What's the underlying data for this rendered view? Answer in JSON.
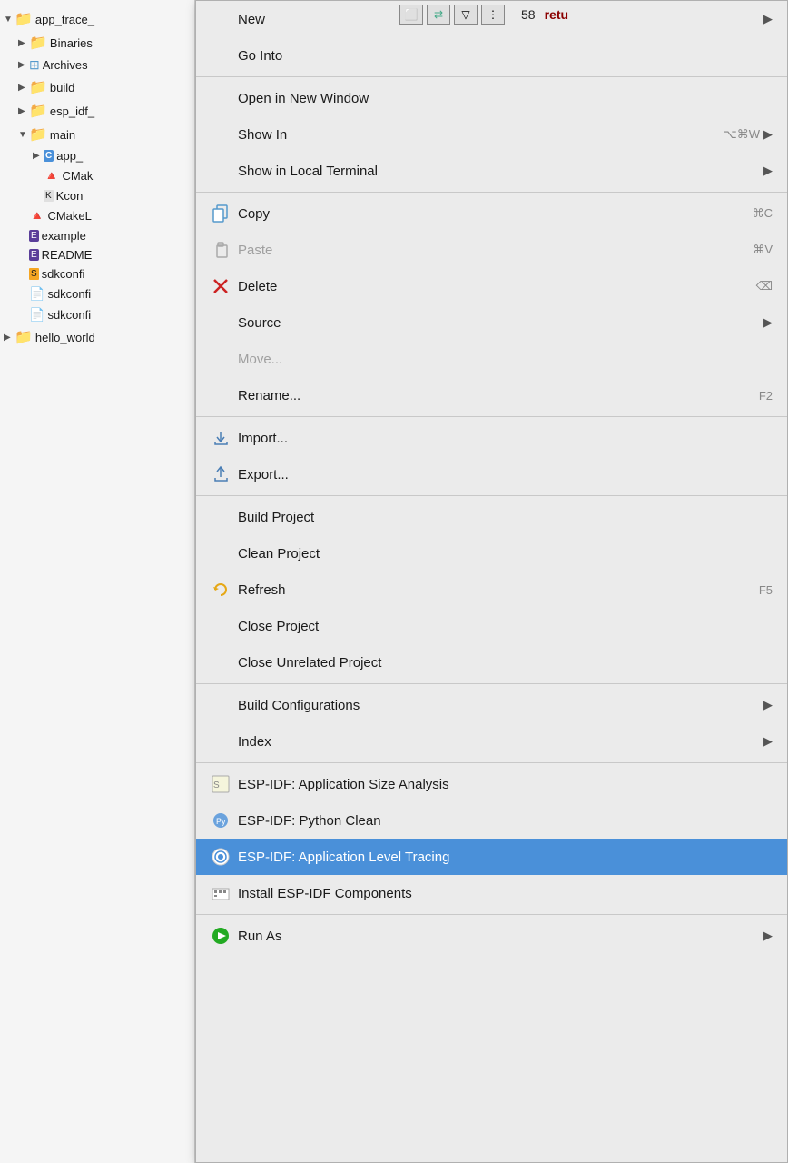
{
  "toolbar": {
    "line_number": "58",
    "return_text": "retu"
  },
  "sidebar": {
    "items": [
      {
        "id": "app_trace",
        "label": "app_trace_",
        "indent": 1,
        "arrow": "expanded",
        "icon": "project"
      },
      {
        "id": "binaries",
        "label": "Binaries",
        "indent": 2,
        "arrow": "collapsed",
        "icon": "folder"
      },
      {
        "id": "archives",
        "label": "Archives",
        "indent": 2,
        "arrow": "collapsed",
        "icon": "grid"
      },
      {
        "id": "build",
        "label": "build",
        "indent": 2,
        "arrow": "collapsed",
        "icon": "folder"
      },
      {
        "id": "esp_idf",
        "label": "esp_idf_",
        "indent": 2,
        "arrow": "collapsed",
        "icon": "folder"
      },
      {
        "id": "main",
        "label": "main",
        "indent": 2,
        "arrow": "expanded",
        "icon": "folder"
      },
      {
        "id": "app_c",
        "label": "app_",
        "indent": 3,
        "arrow": "collapsed",
        "icon": "c-file"
      },
      {
        "id": "cmake_main",
        "label": "CMak",
        "indent": 3,
        "arrow": "leaf",
        "icon": "cmake"
      },
      {
        "id": "kcon",
        "label": "Kcon",
        "indent": 3,
        "arrow": "leaf",
        "icon": "kconfig"
      },
      {
        "id": "cmakel",
        "label": "CMakeL",
        "indent": 2,
        "arrow": "leaf",
        "icon": "cmake"
      },
      {
        "id": "example",
        "label": "example",
        "indent": 2,
        "arrow": "leaf",
        "icon": "esp-file"
      },
      {
        "id": "readme",
        "label": "README",
        "indent": 2,
        "arrow": "leaf",
        "icon": "esp-file"
      },
      {
        "id": "sdkconfi1",
        "label": "sdkconfi",
        "indent": 2,
        "arrow": "leaf",
        "icon": "sdk1"
      },
      {
        "id": "sdkconfi2",
        "label": "sdkconfi",
        "indent": 2,
        "arrow": "leaf",
        "icon": "doc"
      },
      {
        "id": "sdkconfi3",
        "label": "sdkconfi",
        "indent": 2,
        "arrow": "leaf",
        "icon": "doc"
      },
      {
        "id": "hello_world",
        "label": "hello_world",
        "indent": 1,
        "arrow": "collapsed",
        "icon": "folder"
      }
    ]
  },
  "context_menu": {
    "items": [
      {
        "id": "new",
        "label": "New",
        "type": "arrow",
        "shortcut": "",
        "icon": "none",
        "disabled": false
      },
      {
        "id": "go_into",
        "label": "Go Into",
        "type": "normal",
        "shortcut": "",
        "icon": "none",
        "disabled": false
      },
      {
        "id": "sep1",
        "type": "separator"
      },
      {
        "id": "open_new_window",
        "label": "Open in New Window",
        "type": "normal",
        "shortcut": "",
        "icon": "none",
        "disabled": false
      },
      {
        "id": "show_in",
        "label": "Show In",
        "type": "arrow",
        "shortcut": "⌥⌘W",
        "icon": "none",
        "disabled": false
      },
      {
        "id": "show_local_terminal",
        "label": "Show in Local Terminal",
        "type": "arrow",
        "shortcut": "",
        "icon": "none",
        "disabled": false
      },
      {
        "id": "sep2",
        "type": "separator"
      },
      {
        "id": "copy",
        "label": "Copy",
        "type": "normal",
        "shortcut": "⌘C",
        "icon": "copy",
        "disabled": false
      },
      {
        "id": "paste",
        "label": "Paste",
        "type": "normal",
        "shortcut": "⌘V",
        "icon": "paste",
        "disabled": true
      },
      {
        "id": "delete",
        "label": "Delete",
        "type": "normal",
        "shortcut": "⌫",
        "icon": "delete",
        "disabled": false
      },
      {
        "id": "source",
        "label": "Source",
        "type": "arrow",
        "shortcut": "",
        "icon": "none",
        "disabled": false
      },
      {
        "id": "move",
        "label": "Move...",
        "type": "normal",
        "shortcut": "",
        "icon": "none",
        "disabled": true
      },
      {
        "id": "rename",
        "label": "Rename...",
        "type": "normal",
        "shortcut": "F2",
        "icon": "none",
        "disabled": false
      },
      {
        "id": "sep3",
        "type": "separator"
      },
      {
        "id": "import",
        "label": "Import...",
        "type": "normal",
        "shortcut": "",
        "icon": "import",
        "disabled": false
      },
      {
        "id": "export",
        "label": "Export...",
        "type": "normal",
        "shortcut": "",
        "icon": "export",
        "disabled": false
      },
      {
        "id": "sep4",
        "type": "separator"
      },
      {
        "id": "build_project",
        "label": "Build Project",
        "type": "normal",
        "shortcut": "",
        "icon": "none",
        "disabled": false
      },
      {
        "id": "clean_project",
        "label": "Clean Project",
        "type": "normal",
        "shortcut": "",
        "icon": "none",
        "disabled": false
      },
      {
        "id": "refresh",
        "label": "Refresh",
        "type": "normal",
        "shortcut": "F5",
        "icon": "refresh",
        "disabled": false
      },
      {
        "id": "close_project",
        "label": "Close Project",
        "type": "normal",
        "shortcut": "",
        "icon": "none",
        "disabled": false
      },
      {
        "id": "close_unrelated",
        "label": "Close Unrelated Project",
        "type": "normal",
        "shortcut": "",
        "icon": "none",
        "disabled": false
      },
      {
        "id": "sep5",
        "type": "separator"
      },
      {
        "id": "build_configs",
        "label": "Build Configurations",
        "type": "arrow",
        "shortcut": "",
        "icon": "none",
        "disabled": false
      },
      {
        "id": "index",
        "label": "Index",
        "type": "arrow",
        "shortcut": "",
        "icon": "none",
        "disabled": false
      },
      {
        "id": "sep6",
        "type": "separator"
      },
      {
        "id": "esp_app_size",
        "label": "ESP-IDF: Application Size Analysis",
        "type": "normal",
        "shortcut": "",
        "icon": "esp-size",
        "disabled": false
      },
      {
        "id": "esp_python_clean",
        "label": "ESP-IDF: Python Clean",
        "type": "normal",
        "shortcut": "",
        "icon": "esp-python",
        "disabled": false
      },
      {
        "id": "esp_app_trace",
        "label": "ESP-IDF: Application Level Tracing",
        "type": "normal",
        "shortcut": "",
        "icon": "esp-trace",
        "highlighted": true,
        "disabled": false
      },
      {
        "id": "esp_install",
        "label": "Install ESP-IDF Components",
        "type": "normal",
        "shortcut": "",
        "icon": "esp-install",
        "disabled": false
      },
      {
        "id": "sep7",
        "type": "separator"
      },
      {
        "id": "run_as",
        "label": "Run As",
        "type": "arrow",
        "shortcut": "",
        "icon": "run",
        "disabled": false
      }
    ]
  }
}
